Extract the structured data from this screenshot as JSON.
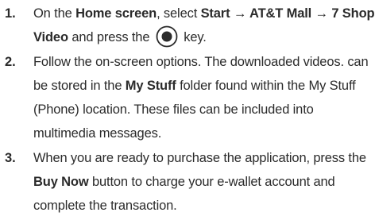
{
  "steps": [
    {
      "number": "1.",
      "line1_a": "On the ",
      "line1_b": "Home screen",
      "line1_c": ", select ",
      "line1_d": "Start → AT&T Mall → 7 Shop",
      "line2_a": "Video",
      "line2_b": " and press the ",
      "line2_c": " key.",
      "icon": "center-select-key-icon"
    },
    {
      "number": "2.",
      "line1": "Follow the on-screen options. The downloaded videos. can",
      "line2_a": "be stored in the ",
      "line2_b": "My Stuff",
      "line2_c": " folder found within the My Stuff",
      "line3": "(Phone) location. These files can be included into",
      "line4": "multimedia messages."
    },
    {
      "number": "3.",
      "line1": "When you are ready to purchase the application, press the",
      "line2_a": "Buy Now",
      "line2_b": " button to charge your e-wallet account and",
      "line3": "complete the transaction."
    }
  ],
  "colors": {
    "text": "#2b2b2b",
    "background": "#ffffff"
  }
}
